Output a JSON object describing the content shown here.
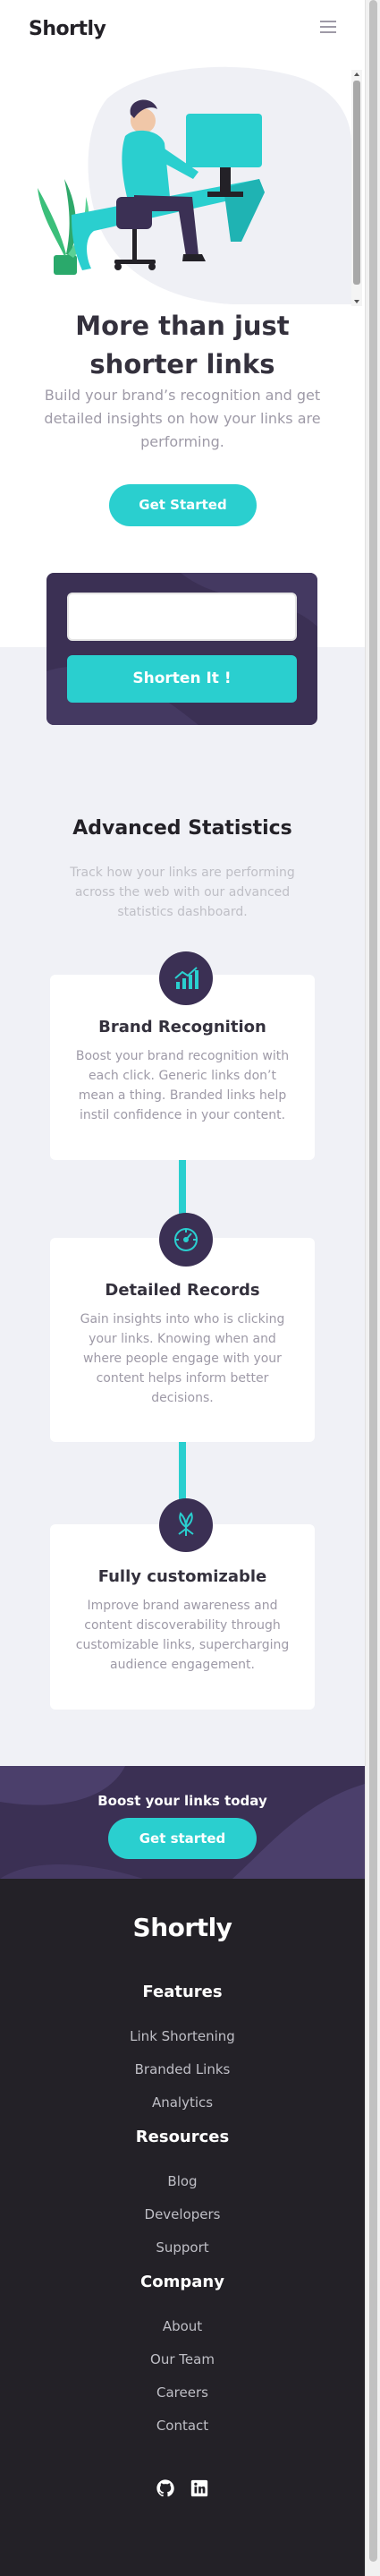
{
  "header": {
    "logo": "Shortly",
    "menu_icon": "hamburger-icon"
  },
  "hero": {
    "title": "More than just shorter links",
    "subtitle": "Build your brand’s recognition and get detailed insights on how your links are performing.",
    "cta_label": "Get Started",
    "illustration": "person-working-at-desk-illustration"
  },
  "shorten": {
    "input_value": "",
    "input_placeholder": "",
    "button_label": "Shorten It !"
  },
  "stats": {
    "title": "Advanced Statistics",
    "subtitle": "Track how your links are performing across the web with our advanced statistics dashboard.",
    "cards": [
      {
        "icon": "chart-icon",
        "title": "Brand Recognition",
        "text": "Boost your brand recognition with each click. Generic links don’t mean a thing. Branded links help instil confidence in your content."
      },
      {
        "icon": "gauge-icon",
        "title": "Detailed Records",
        "text": "Gain insights into who is clicking your links. Knowing when and where people engage with your content helps inform better decisions."
      },
      {
        "icon": "brush-pen-icon",
        "title": "Fully customizable",
        "text": "Improve brand awareness and content discoverability through customizable links, supercharging audience engagement."
      }
    ]
  },
  "boost": {
    "title": "Boost your links today",
    "cta_label": "Get started"
  },
  "footer": {
    "logo": "Shortly",
    "columns": [
      {
        "heading": "Features",
        "links": [
          "Link Shortening",
          "Branded Links",
          "Analytics"
        ]
      },
      {
        "heading": "Resources",
        "links": [
          "Blog",
          "Developers",
          "Support"
        ]
      },
      {
        "heading": "Company",
        "links": [
          "About",
          "Our Team",
          "Careers",
          "Contact"
        ]
      }
    ],
    "social": [
      "github-icon",
      "linkedin-icon"
    ]
  },
  "colors": {
    "cyan": "#2acfcf",
    "dark_violet": "#3b3054",
    "very_dark_violet": "#232127",
    "grayish_violet": "#9e9aa7",
    "light_gray": "#f0f1f6"
  }
}
